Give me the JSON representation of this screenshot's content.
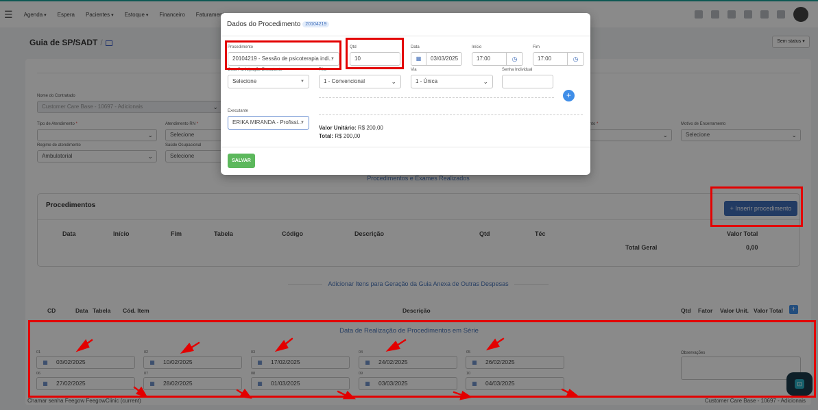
{
  "nav": {
    "items": [
      {
        "label": "Agenda",
        "dropdown": true
      },
      {
        "label": "Espera",
        "dropdown": false
      },
      {
        "label": "Pacientes",
        "dropdown": true
      },
      {
        "label": "Estoque",
        "dropdown": true
      },
      {
        "label": "Financeiro",
        "dropdown": false
      },
      {
        "label": "Faturamento",
        "dropdown": false
      }
    ]
  },
  "page": {
    "title": "Guia de SP/SADT",
    "status_label": "Sem status"
  },
  "form": {
    "contratado_label": "Nome do Contratado",
    "contratado_value": "Customer Care Base - 10697 - Adicionais",
    "tipo_atendimento_label": "Tipo de Atendimento",
    "atendimento_rn_label": "Atendimento RN",
    "atendimento_rn_value": "Selecione",
    "regime_label": "Regime de atendimento",
    "regime_value": "Ambulatorial",
    "saude_ocup_label": "Saúde Ocupacional",
    "saude_ocup_value": "Selecione",
    "motivo_label": "Motivo de Encerramento",
    "motivo_value": "Selecione",
    "partial_label": "nto"
  },
  "procedimentos": {
    "section_title": "Procedimentos e Exames Realizados",
    "box_title": "Procedimentos",
    "insert_button": "Inserir procedimento",
    "columns": [
      "Data",
      "Início",
      "Fim",
      "Tabela",
      "Código",
      "Descrição",
      "Qtd",
      "Téc",
      "Valor Total"
    ],
    "total_label": "Total Geral",
    "total_value": "0,00"
  },
  "despesas": {
    "section_title": "Adicionar Itens para Geração da Guia Anexa de Outras Despesas",
    "columns": [
      "CD",
      "Data",
      "Tabela",
      "Cód. Item",
      "Descrição",
      "Qtd",
      "Fator",
      "Valor Unit.",
      "Valor Total"
    ],
    "add_label": "+"
  },
  "serie": {
    "title": "Data de Realização de Procedimentos em Série",
    "dates": [
      {
        "num": "01",
        "value": "03/02/2025"
      },
      {
        "num": "02",
        "value": "10/02/2025"
      },
      {
        "num": "03",
        "value": "17/02/2025"
      },
      {
        "num": "04",
        "value": "24/02/2025"
      },
      {
        "num": "05",
        "value": "26/02/2025"
      },
      {
        "num": "06",
        "value": "27/02/2025"
      },
      {
        "num": "07",
        "value": "28/02/2025"
      },
      {
        "num": "08",
        "value": "01/03/2025"
      },
      {
        "num": "09",
        "value": "03/03/2025"
      },
      {
        "num": "10",
        "value": "04/03/2025"
      }
    ],
    "obs_label": "Observações"
  },
  "footer": {
    "left": "Chamar senha  Feegow FeegowClinic (current)",
    "right": "Customer Care Base - 10697 - Adicionais"
  },
  "modal": {
    "title": "Dados do Procedimento",
    "badge": "20104219",
    "procedimento_label": "Procedimento",
    "procedimento_value": "20104219 - Sessão de psicoterapia indi...",
    "qtd_label": "Qtd",
    "qtd_value": "10",
    "data_label": "Data",
    "data_value": "03/03/2025",
    "inicio_label": "Início",
    "inicio_value": "17:00",
    "fim_label": "Fim",
    "fim_value": "17:00",
    "grau_label": "Grau Participação Executante",
    "grau_value": "Selecione",
    "tec_label": "Téc.",
    "tec_value": "1 - Convencional",
    "via_label": "Via",
    "via_value": "1 - Única",
    "senha_label": "Senha Individual",
    "senha_value": "",
    "executante_label": "Executante",
    "executante_value": "ERIKA MIRANDA - Profissi...",
    "valor_unit_label": "Valor Unitário:",
    "valor_unit_value": "R$ 200,00",
    "total_label": "Total:",
    "total_value": "R$ 200,00",
    "save_button": "SALVAR"
  },
  "colors": {
    "highlight": "#e30000",
    "primary": "#3f6db8",
    "success": "#5cb85c"
  }
}
